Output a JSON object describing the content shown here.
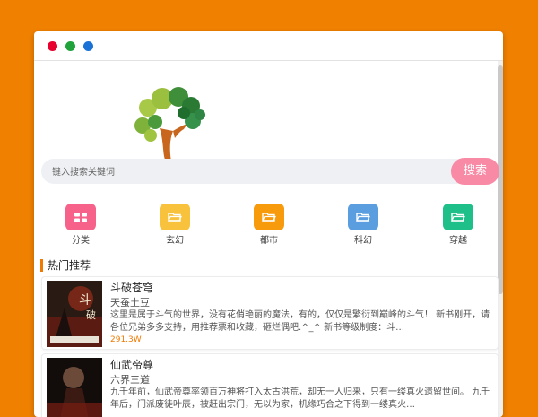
{
  "search": {
    "placeholder": "键入搜索关键词",
    "button_label": "搜索"
  },
  "categories": [
    {
      "label": "分类",
      "icon": "grid-icon",
      "color": "#f6628a"
    },
    {
      "label": "玄幻",
      "icon": "folder-icon",
      "color": "#f9c23c"
    },
    {
      "label": "都市",
      "icon": "folder-icon",
      "color": "#f79a0c"
    },
    {
      "label": "科幻",
      "icon": "folder-icon",
      "color": "#5b9ee0"
    },
    {
      "label": "穿越",
      "icon": "folder-icon",
      "color": "#1fbf8a"
    }
  ],
  "section": {
    "title": "热门推荐"
  },
  "books": [
    {
      "title": "斗破苍穹",
      "author": "天蚕土豆",
      "desc": "这里是属于斗气的世界，没有花俏艳丽的魔法，有的，仅仅是繁衍到巅峰的斗气！ 新书刚开，请各位兄弟多多支持，用推荐票和收藏，砸烂偶吧.^_^ 新书等级制度：斗…",
      "count": "291.3W"
    },
    {
      "title": "仙武帝尊",
      "author": "六界三道",
      "desc": "九千年前，仙武帝尊率领百万神将打入太古洪荒，却无一人归来，只有一缕真火遗留世间。 九千年后，门派废徒叶辰，被赶出宗门，无以为家，机缘巧合之下得到一缕真火…",
      "count": ""
    }
  ],
  "colors": {
    "background": "#f08000",
    "accent": "#f07a00",
    "search_button": "#f98aa5"
  }
}
